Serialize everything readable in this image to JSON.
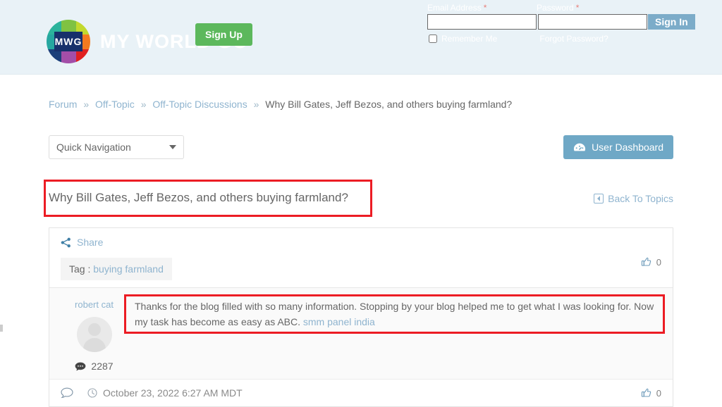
{
  "header": {
    "logo_text": "MWG",
    "wordmark": "MY WORLD GO",
    "signup_label": "Sign Up",
    "login": {
      "email_label": "Email Address",
      "password_label": "Password",
      "required_mark": "*",
      "email_value": "",
      "password_value": "",
      "email_placeholder": "",
      "password_placeholder": "",
      "signin_label": "Sign In",
      "remember_label": "Remember Me",
      "forgot_label": "Forgot Password?"
    }
  },
  "breadcrumb": {
    "items": [
      {
        "label": "Forum",
        "link": true
      },
      {
        "label": "Off-Topic",
        "link": true
      },
      {
        "label": "Off-Topic Discussions",
        "link": true
      },
      {
        "label": "Why Bill Gates, Jeff Bezos, and others buying farmland?",
        "link": false
      }
    ],
    "separator": "»"
  },
  "toolbar": {
    "quick_nav_label": "Quick Navigation",
    "dashboard_label": "User Dashboard"
  },
  "topic": {
    "title": "Why Bill Gates, Jeff Bezos, and others buying farmland?",
    "back_label": "Back To Topics",
    "share_label": "Share",
    "tag_prefix": "Tag :",
    "tag_value": "buying farmland",
    "topic_like_count": "0"
  },
  "post": {
    "author": "robert cat",
    "post_count": "2287",
    "message_part1": "Thanks for the blog filled with so many information. Stopping by your blog helped me to get what I was looking for. Now my task has become as easy as ABC.",
    "message_link": "smm panel india",
    "timestamp": "October 23, 2022 6:27 AM MDT",
    "like_count": "0"
  },
  "colors": {
    "header_bg": "#e9f2f7",
    "signup_green": "#5cb85c",
    "signin_blue": "#7cacc9",
    "dashboard_blue": "#6fa8c6",
    "link_blue": "#8fb4cf",
    "annotation_red": "#ec1c24"
  }
}
